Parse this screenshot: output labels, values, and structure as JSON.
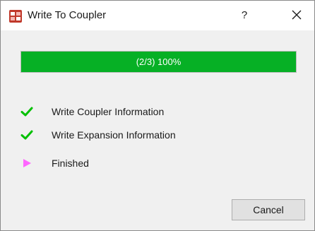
{
  "window": {
    "title": "Write To Coupler",
    "help_label": "?",
    "app_icon": "coupler-app-icon",
    "close_icon": "close-icon"
  },
  "progress": {
    "text": "(2/3) 100%",
    "fraction": 1.0,
    "fill_color": "#06b025"
  },
  "steps": [
    {
      "label": "Write Coupler Information",
      "icon": "checkmark-icon",
      "status": "done",
      "color": "#00c000"
    },
    {
      "label": "Write Expansion Information",
      "icon": "checkmark-icon",
      "status": "done",
      "color": "#00c000"
    },
    {
      "label": "Finished",
      "icon": "arrow-right-icon",
      "status": "current",
      "color": "#ff66ff"
    }
  ],
  "buttons": {
    "cancel_label": "Cancel"
  }
}
